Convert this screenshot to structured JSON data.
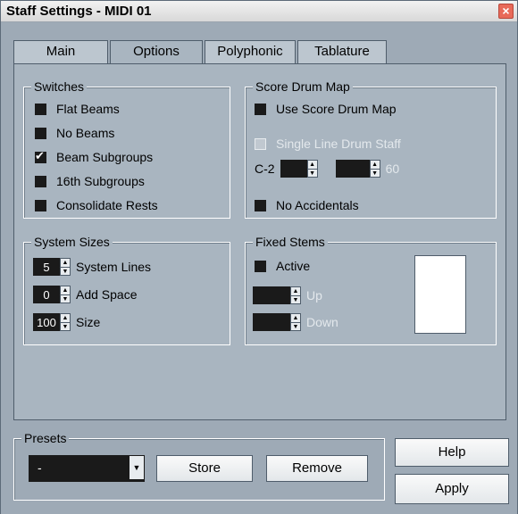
{
  "window": {
    "title": "Staff Settings - MIDI 01",
    "close_label": "×"
  },
  "tabs": [
    {
      "label": "Main",
      "active": false
    },
    {
      "label": "Options",
      "active": true
    },
    {
      "label": "Polyphonic",
      "active": false
    },
    {
      "label": "Tablature",
      "active": false
    }
  ],
  "switches": {
    "label": "Switches",
    "items": [
      {
        "label": "Flat Beams",
        "checked": false
      },
      {
        "label": "No Beams",
        "checked": false
      },
      {
        "label": "Beam Subgroups",
        "checked": true
      },
      {
        "label": "16th Subgroups",
        "checked": false
      },
      {
        "label": "Consolidate Rests",
        "checked": false
      }
    ]
  },
  "score_drum_map": {
    "label": "Score Drum Map",
    "use_label": "Use Score Drum Map",
    "single_line_label": "Single Line Drum Staff",
    "range_low_label": "C-2",
    "range_low_value": "",
    "range_high_value": "",
    "range_high_suffix": "60",
    "no_accidentals_label": "No Accidentals"
  },
  "system_sizes": {
    "label": "System Sizes",
    "system_lines_value": "5",
    "system_lines_label": "System Lines",
    "add_space_value": "0",
    "add_space_label": "Add Space",
    "size_value": "100",
    "size_label": "Size"
  },
  "fixed_stems": {
    "label": "Fixed Stems",
    "active_label": "Active",
    "up_value": "",
    "up_label": "Up",
    "down_value": "",
    "down_label": "Down"
  },
  "presets": {
    "label": "Presets",
    "selected": "-",
    "store_label": "Store",
    "remove_label": "Remove"
  },
  "buttons": {
    "help_label": "Help",
    "apply_label": "Apply"
  },
  "colors": {
    "window_bg": "#9eaab6",
    "panel_bg": "#a9b5c0",
    "field_bg": "#1a1a1a",
    "close_button": "#e86a5a"
  }
}
